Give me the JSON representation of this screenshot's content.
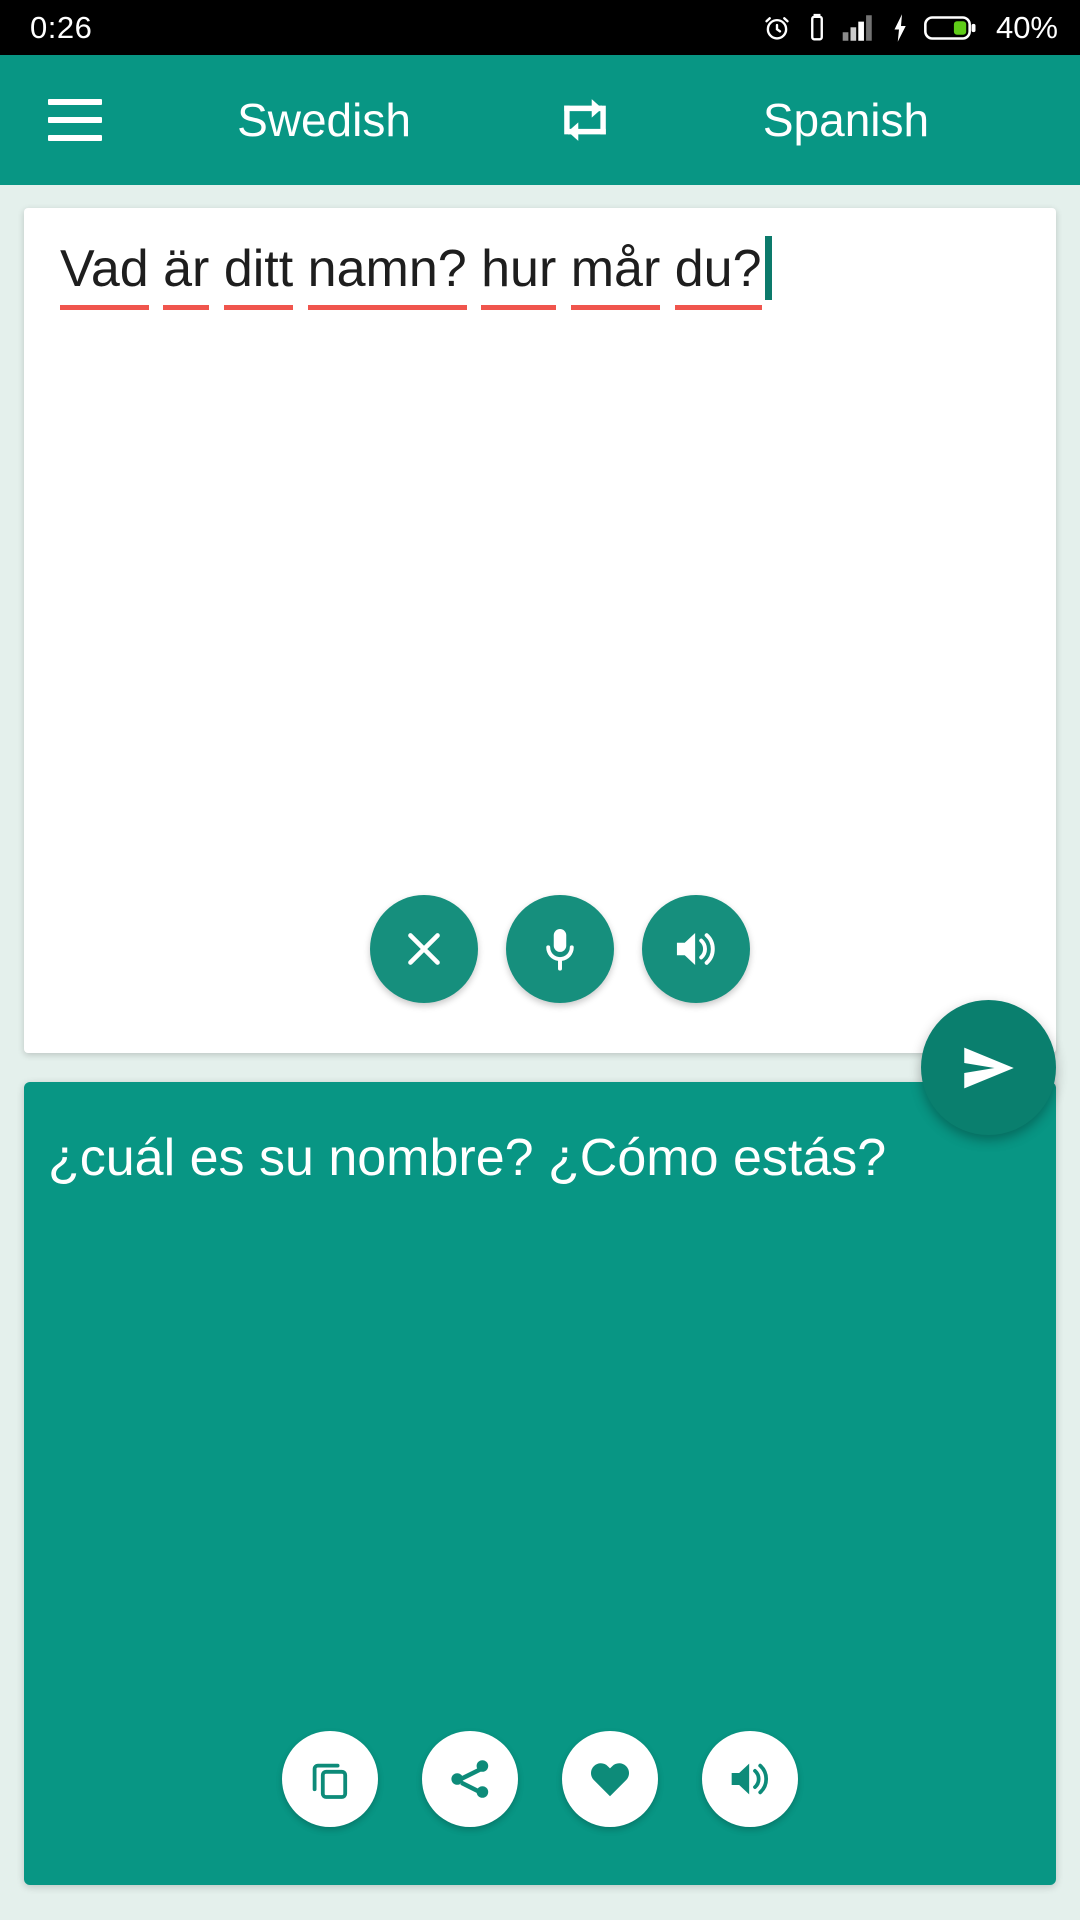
{
  "status_bar": {
    "time": "0:26",
    "battery_percent": "40%",
    "icons": [
      "alarm-clock-icon",
      "vibrate-icon",
      "signal-bars-icon",
      "charging-bolt-icon",
      "battery-icon"
    ]
  },
  "app_bar": {
    "menu_label": "menu",
    "source_language": "Swedish",
    "swap_label": "swap-languages",
    "target_language": "Spanish",
    "background_color": "#089684"
  },
  "source_panel": {
    "text": "Vad är ditt namn? hur mår du?",
    "words": [
      "Vad",
      "är",
      "ditt",
      "namn?",
      "hur",
      "mår",
      "du?"
    ],
    "spellcheck_underline_color": "#f0554d",
    "caret_visible": true,
    "caret_color": "#0c7a6b",
    "actions": [
      {
        "name": "clear-button",
        "icon": "close-icon",
        "label": "Clear"
      },
      {
        "name": "mic-button",
        "icon": "microphone-icon",
        "label": "Voice input"
      },
      {
        "name": "speak-source-button",
        "icon": "speaker-icon",
        "label": "Listen"
      }
    ]
  },
  "send_button": {
    "icon": "send-icon",
    "label": "Translate",
    "color": "#0a7f6e"
  },
  "target_panel": {
    "text": "¿cuál es su nombre? ¿Cómo estás?",
    "background_color": "#089684",
    "actions": [
      {
        "name": "copy-button",
        "icon": "copy-icon",
        "label": "Copy"
      },
      {
        "name": "share-button",
        "icon": "share-icon",
        "label": "Share"
      },
      {
        "name": "favorite-button",
        "icon": "heart-icon",
        "label": "Favorite"
      },
      {
        "name": "speak-target-button",
        "icon": "speaker-icon",
        "label": "Listen"
      }
    ]
  }
}
